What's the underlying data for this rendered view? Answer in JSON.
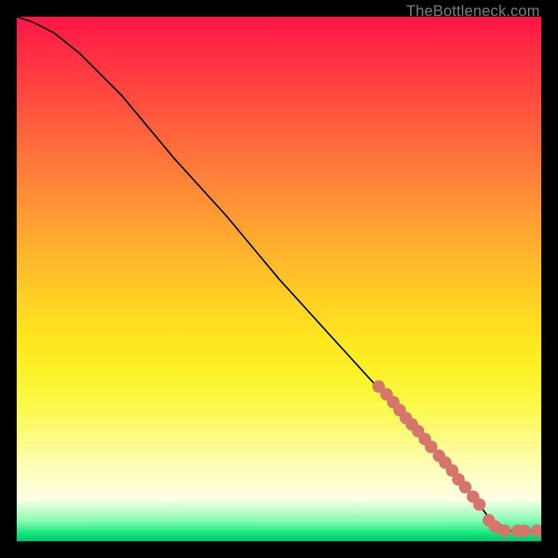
{
  "attribution": "TheBottleneck.com",
  "colors": {
    "marker": "#d6756b",
    "curve": "#000000",
    "gradient_stops": [
      "#ff1446",
      "#ff2b43",
      "#ff4640",
      "#ff6a3c",
      "#ff8d37",
      "#ffb02e",
      "#ffd123",
      "#fde81e",
      "#fbf22a",
      "#fbf948",
      "#fcfb7e",
      "#fdfdb8",
      "#fefee6",
      "#8afcb6",
      "#12e67a",
      "#00c26f"
    ]
  },
  "chart_data": {
    "type": "line",
    "title": "",
    "xlabel": "",
    "ylabel": "",
    "xlim": [
      0,
      100
    ],
    "ylim": [
      0,
      100
    ],
    "grid": false,
    "legend": false,
    "series": [
      {
        "name": "curve",
        "x": [
          0,
          3,
          7,
          12,
          20,
          30,
          40,
          50,
          60,
          70,
          80,
          86,
          90,
          94,
          100
        ],
        "y": [
          100,
          99,
          97,
          93,
          85,
          73,
          62,
          50,
          39,
          28,
          17,
          10,
          4.5,
          2,
          2
        ]
      }
    ],
    "markers": [
      {
        "x": 69.0,
        "y": 29.5
      },
      {
        "x": 70.5,
        "y": 28.0
      },
      {
        "x": 71.8,
        "y": 26.5
      },
      {
        "x": 73.0,
        "y": 25.0
      },
      {
        "x": 74.2,
        "y": 23.5
      },
      {
        "x": 75.3,
        "y": 22.3
      },
      {
        "x": 76.5,
        "y": 21.0
      },
      {
        "x": 77.8,
        "y": 19.5
      },
      {
        "x": 79.0,
        "y": 18.0
      },
      {
        "x": 80.5,
        "y": 16.3
      },
      {
        "x": 81.7,
        "y": 15.0
      },
      {
        "x": 83.0,
        "y": 13.5
      },
      {
        "x": 84.2,
        "y": 11.8
      },
      {
        "x": 85.5,
        "y": 10.3
      },
      {
        "x": 87.0,
        "y": 8.5
      },
      {
        "x": 88.2,
        "y": 7.0
      },
      {
        "x": 90.0,
        "y": 4.0
      },
      {
        "x": 91.2,
        "y": 2.8
      },
      {
        "x": 93.0,
        "y": 2.0
      },
      {
        "x": 95.5,
        "y": 2.0
      },
      {
        "x": 96.8,
        "y": 2.0
      },
      {
        "x": 99.2,
        "y": 2.0
      }
    ]
  }
}
